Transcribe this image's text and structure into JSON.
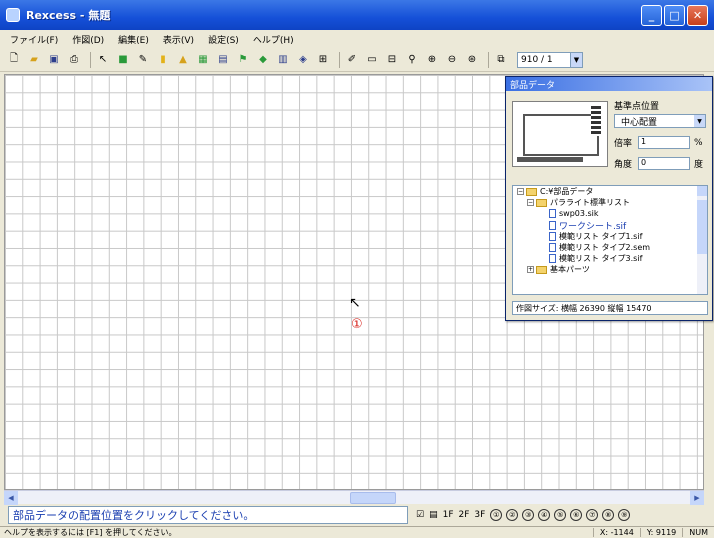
{
  "window": {
    "title": "Rexcess - 無題"
  },
  "menu": [
    "ファイル(F)",
    "作図(D)",
    "編集(E)",
    "表示(V)",
    "設定(S)",
    "ヘルプ(H)"
  ],
  "toolbar": {
    "zoom_value": "910 / 1"
  },
  "panel": {
    "title": "部品データ",
    "position_label": "基準点位置",
    "position_value": "中心配置",
    "scale_label": "倍率",
    "scale_value": "1",
    "scale_unit": "%",
    "angle_label": "角度",
    "angle_value": "0",
    "angle_unit": "度",
    "tree": {
      "root": "C:¥部品データ",
      "child": "パラライト標準リスト",
      "items": [
        "swp03.sik",
        "ワークシート.sif",
        "模範リスト タイプ1.sif",
        "模範リスト タイプ2.sem",
        "模範リスト タイプ3.sif"
      ],
      "sibling": "基本パーツ"
    },
    "size_text": "作図サイズ: 横幅 26390  縦幅 15470"
  },
  "canvas": {
    "marker": "①"
  },
  "message": "部品データの配置位置をクリックしてください。",
  "floors": [
    "1F",
    "2F",
    "3F"
  ],
  "floor_circles": [
    "①",
    "②",
    "③",
    "④",
    "⑤",
    "⑥",
    "⑦",
    "⑧",
    "⑨"
  ],
  "status": {
    "help": "ヘルプを表示するには [F1] を押してください。",
    "x": "X: -1144",
    "y": "Y: 9119",
    "num": "NUM"
  }
}
